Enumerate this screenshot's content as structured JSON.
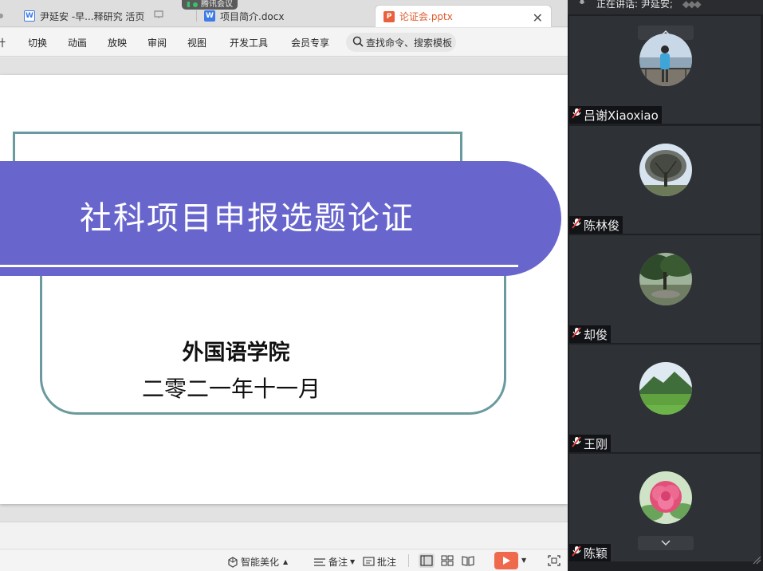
{
  "tabs": [
    {
      "label": "尹延安 -早...释研究 活页",
      "icon": "word-doc-icon"
    },
    {
      "label": "项目简介.docx",
      "icon": "word-doc-icon"
    },
    {
      "label": "论证会.pptx",
      "icon": "ppt-icon",
      "active": true
    }
  ],
  "meeting_badge": "腾讯会议",
  "ribbon": {
    "items": [
      "计",
      "切换",
      "动画",
      "放映",
      "审阅",
      "视图",
      "开发工具",
      "会员专享"
    ],
    "search_placeholder": "查找命令、搜索模板"
  },
  "slide": {
    "title": "社科项目申报选题论证",
    "subtitle_org": "外国语学院",
    "subtitle_date": "二零二一年十一月"
  },
  "statusbar": {
    "smart_beautify": "智能美化",
    "notes": "备注",
    "comments": "批注"
  },
  "panel": {
    "speaking": "正在讲话: 尹延安;",
    "participants": [
      {
        "name": "吕谢Xiaoxiao",
        "avatar": "person-by-lake-photo"
      },
      {
        "name": "陈林俊",
        "avatar": "bare-tree-photo"
      },
      {
        "name": "却俊",
        "avatar": "garden-trees-photo"
      },
      {
        "name": "王刚",
        "avatar": "green-mountain-photo"
      },
      {
        "name": "陈颖",
        "avatar": "pink-peony-photo"
      }
    ]
  },
  "colors": {
    "banner": "#6866cd",
    "frame": "#6a9a9d",
    "play": "#ef6a4d",
    "active_tab_text": "#e05a2a",
    "panel_bg": "#1f2023"
  }
}
